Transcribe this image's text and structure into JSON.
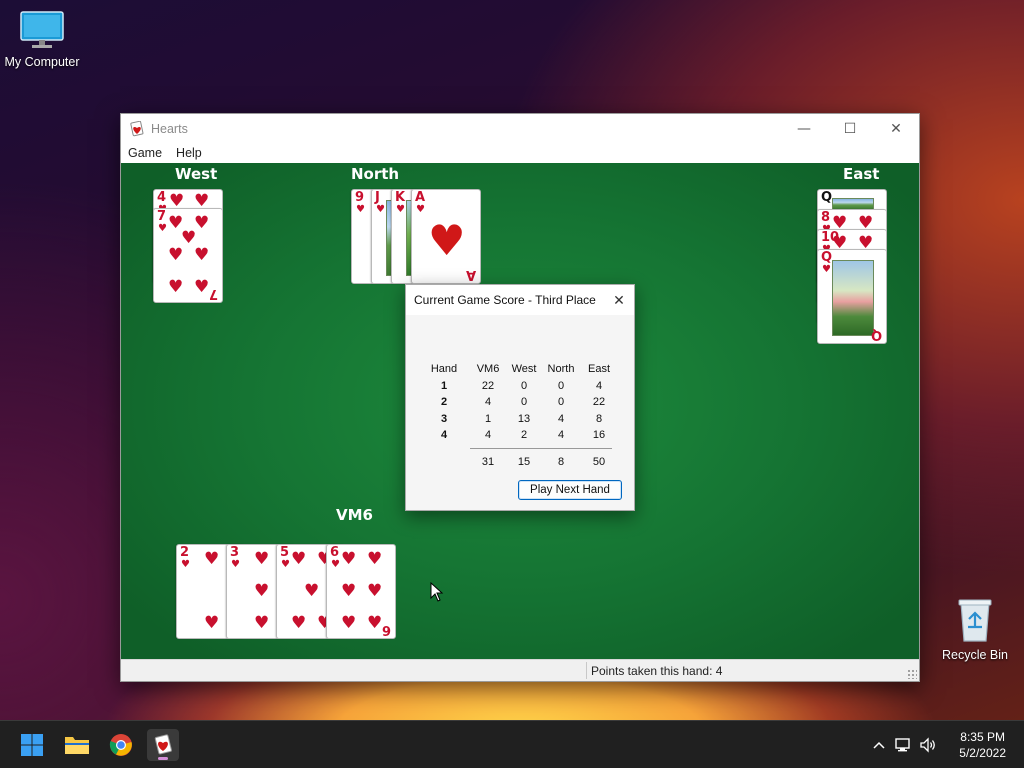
{
  "desktop": {
    "icons": [
      {
        "label": "My Computer",
        "icon": "monitor-icon"
      },
      {
        "label": "Recycle Bin",
        "icon": "recycle-bin-icon"
      }
    ]
  },
  "window": {
    "title": "Hearts",
    "menu": [
      "Game",
      "Help"
    ],
    "controls": {
      "minimize": "—",
      "maximize": "☐",
      "close": "✕"
    },
    "status_text": "Points taken this hand: 4"
  },
  "players": {
    "west": "West",
    "north": "North",
    "east": "East",
    "south": "VM6"
  },
  "cards": {
    "west": [
      "4",
      "7"
    ],
    "north": [
      "9",
      "J",
      "K",
      "A"
    ],
    "east": [
      "Q",
      "8",
      "10",
      "Q"
    ],
    "south": [
      "2",
      "3",
      "5",
      "6"
    ],
    "suit": "♥"
  },
  "dialog": {
    "title": "Current Game Score - Third Place",
    "close": "✕",
    "headers": [
      "Hand",
      "VM6",
      "West",
      "North",
      "East"
    ],
    "rows": [
      [
        "1",
        "22",
        "0",
        "0",
        "4"
      ],
      [
        "2",
        "4",
        "0",
        "0",
        "22"
      ],
      [
        "3",
        "1",
        "13",
        "4",
        "8"
      ],
      [
        "4",
        "4",
        "2",
        "4",
        "16"
      ]
    ],
    "totals": [
      "",
      "31",
      "15",
      "8",
      "50"
    ],
    "button": "Play Next Hand"
  },
  "taskbar": {
    "items": [
      "start-icon",
      "file-explorer-icon",
      "chrome-icon",
      "hearts-icon"
    ],
    "time": "8:35 PM",
    "date": "5/2/2022",
    "tray_chevron": "^"
  },
  "colors": {
    "felt": "#157433",
    "heart_red": "#c8102e",
    "accent": "#0067c0",
    "taskbar": "#202020"
  }
}
